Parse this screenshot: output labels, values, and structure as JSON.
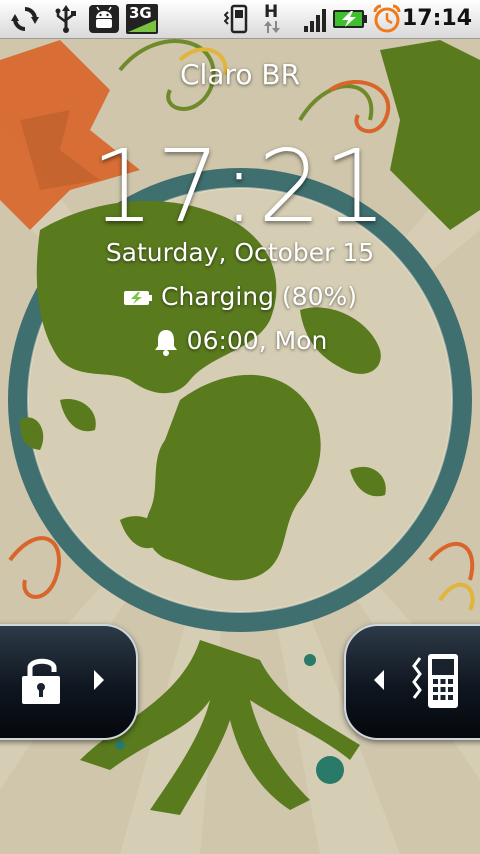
{
  "status_bar": {
    "time": "17:14",
    "network_type": "3G",
    "data_indicator": "H",
    "icons": [
      "sync-icon",
      "usb-icon",
      "android-debug-icon",
      "3g-icon",
      "vibrate-icon",
      "hspa-data-icon",
      "signal-icon",
      "battery-charging-icon",
      "alarm-clock-icon"
    ]
  },
  "lockscreen": {
    "carrier": "Claro BR",
    "time": "17:21",
    "date": "Saturday, October 15",
    "charging": "Charging (80%)",
    "alarm": "06:00, Mon"
  },
  "tabs": {
    "left_icon": "unlock-icon",
    "right_icon": "vibrate-phone-icon"
  },
  "colors": {
    "background": "#cfc6ac",
    "globe_green": "#5a7a1e",
    "ring_teal": "#3f6f6e",
    "accent_orange": "#d9652a"
  }
}
